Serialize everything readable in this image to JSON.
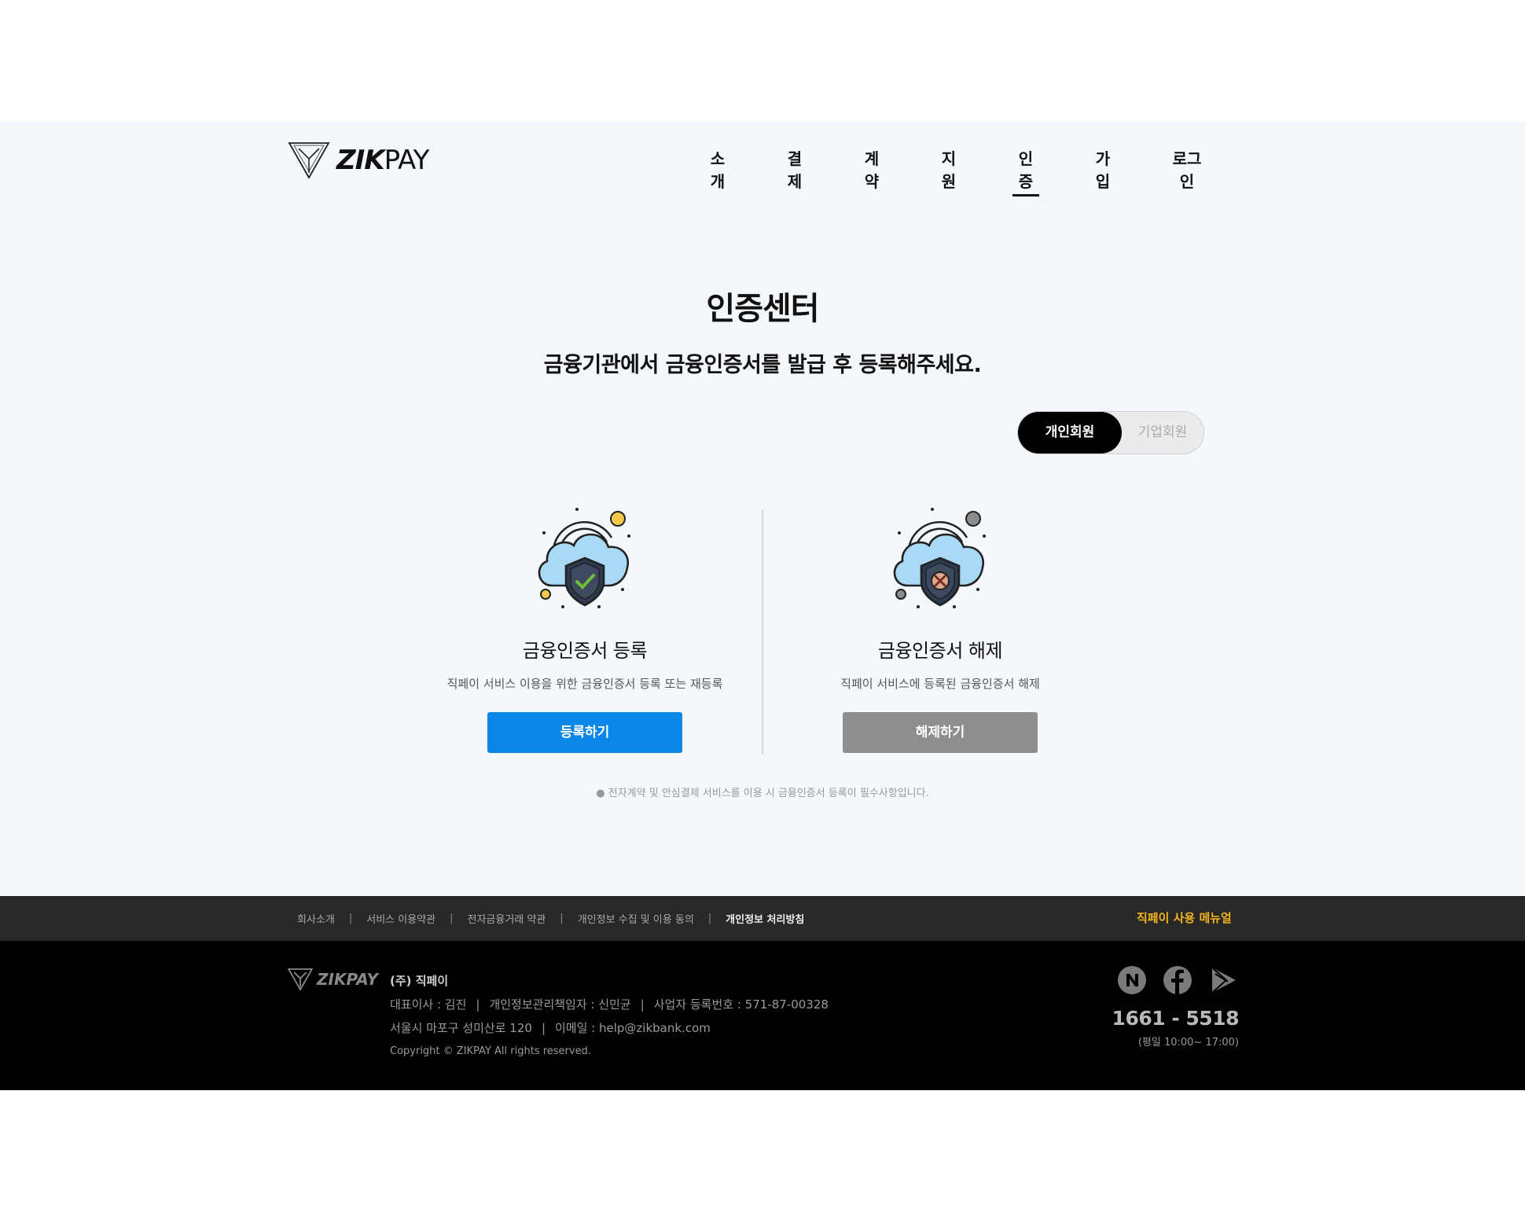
{
  "brand": {
    "name": "ZIKPAY",
    "name_bold": "ZIK",
    "name_thin": "PAY"
  },
  "nav": {
    "items": [
      {
        "label": "소개"
      },
      {
        "label": "결제"
      },
      {
        "label": "계약"
      },
      {
        "label": "지원"
      },
      {
        "label": "인증",
        "active": true
      },
      {
        "label": "가입"
      },
      {
        "label": "로그인"
      }
    ]
  },
  "main": {
    "title": "인증센터",
    "subtitle": "금융기관에서 금융인증서를 발급 후 등록해주세요.",
    "toggle": {
      "on_label": "개인회원",
      "off_label": "기업회원"
    },
    "register": {
      "title": "금융인증서 등록",
      "desc": "직페이 서비스 이용을 위한 금융인증서 등록 또는 재등록",
      "button": "등록하기",
      "icon": "cloud-shield-check-icon"
    },
    "unregister": {
      "title": "금융인증서 해제",
      "desc": "직페이 서비스에 등록된 금융인증서 해제",
      "button": "해제하기",
      "icon": "cloud-shield-x-icon"
    },
    "notice": "● 전자계약 및 안심결제 서비스를 이용 시 금융인증서 등록이 필수사항입니다."
  },
  "footer": {
    "links": [
      "회사소개",
      "서비스 이용약관",
      "전자금융거래 약관",
      "개인정보 수집 및 이용 동의",
      "개인정보 처리방침"
    ],
    "manual": "직페이 사용 메뉴얼",
    "company": "(주) 직페이",
    "ceo": "대표이사 : 김진",
    "privacy_officer": "개인정보관리책임자 : 신민균",
    "biz_no": "사업자 등록번호 : 571-87-00328",
    "address": "서울시 마포구 성미산로 120",
    "email": "이메일 : help@zikbank.com",
    "copyright": "Copyright © ZIKPAY All rights reserved.",
    "phone": "1661 - 5518",
    "hours": "(평일 10:00~ 17:00)",
    "social": [
      "naver-icon",
      "facebook-icon",
      "google-play-icon"
    ]
  },
  "colors": {
    "accent_blue": "#0a86e6",
    "gray_button": "#8e8e8e",
    "manual_yellow": "#f3b51b",
    "band_bg": "#f4f7fb"
  }
}
